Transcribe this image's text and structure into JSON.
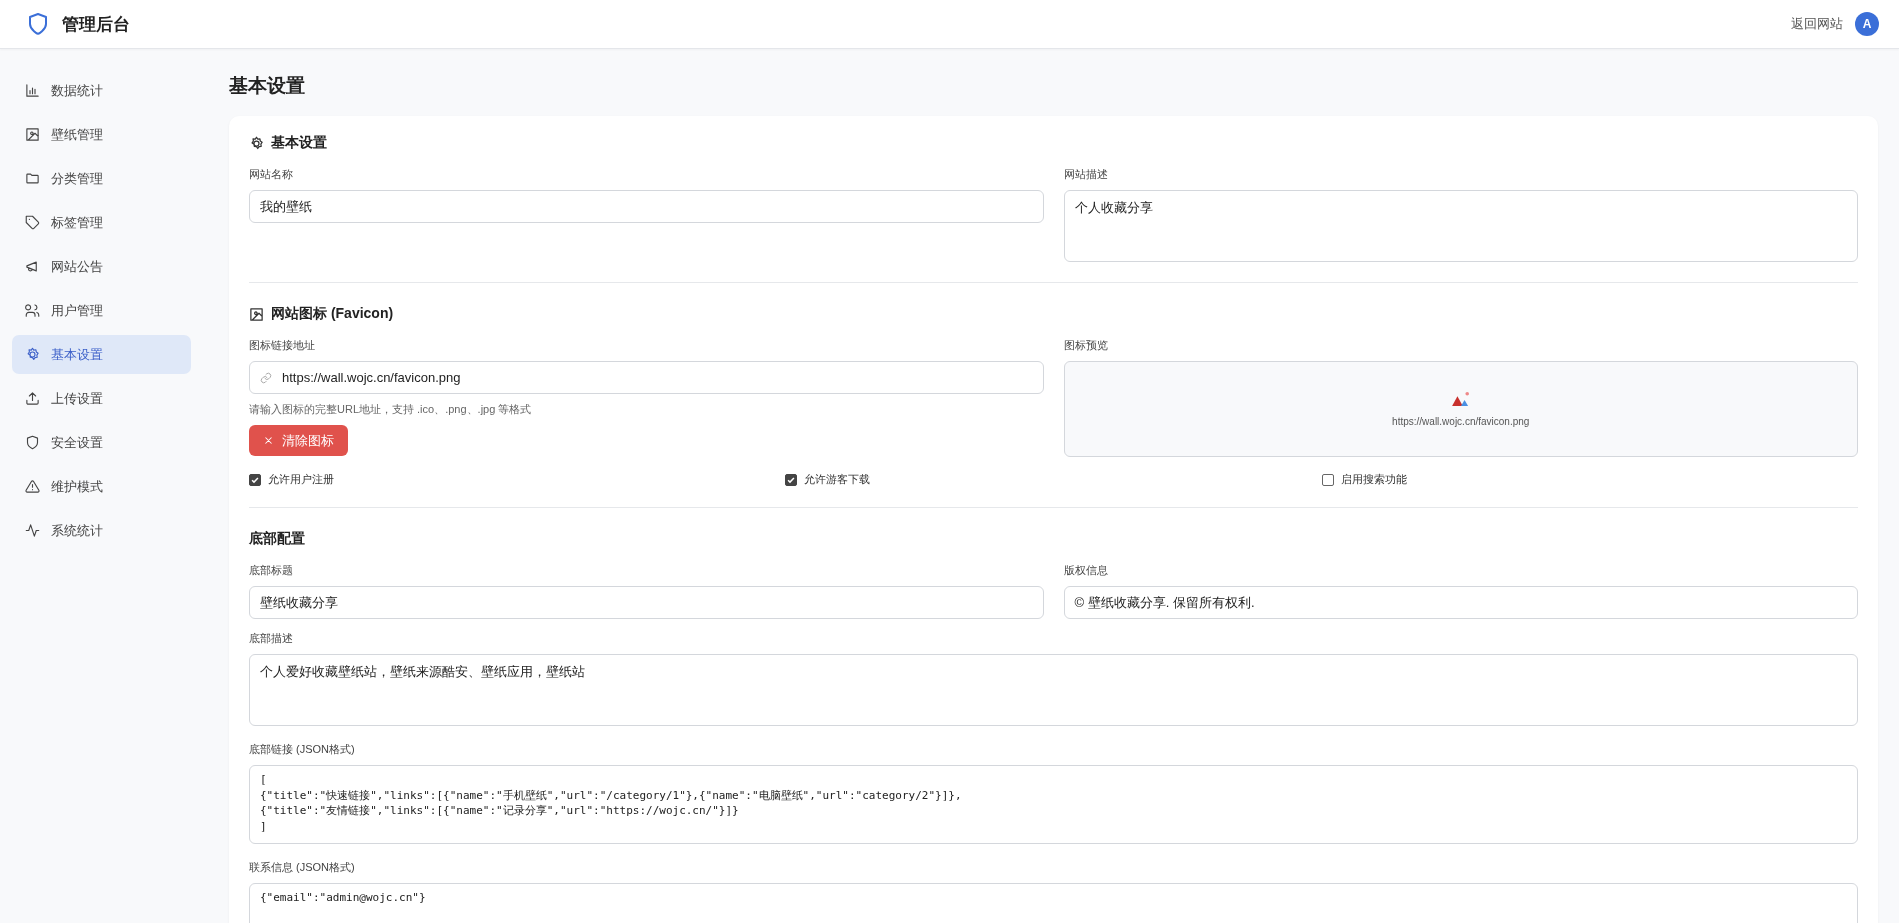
{
  "header": {
    "title": "管理后台",
    "back_link": "返回网站",
    "avatar": "A"
  },
  "sidebar": {
    "items": [
      {
        "label": "数据统计",
        "selected": false
      },
      {
        "label": "壁纸管理",
        "selected": false
      },
      {
        "label": "分类管理",
        "selected": false
      },
      {
        "label": "标签管理",
        "selected": false
      },
      {
        "label": "网站公告",
        "selected": false
      },
      {
        "label": "用户管理",
        "selected": false
      },
      {
        "label": "基本设置",
        "selected": true
      },
      {
        "label": "上传设置",
        "selected": false
      },
      {
        "label": "安全设置",
        "selected": false
      },
      {
        "label": "维护模式",
        "selected": false
      },
      {
        "label": "系统统计",
        "selected": false
      }
    ]
  },
  "page_title": "基本设置",
  "basic": {
    "title": "基本设置",
    "site_name": {
      "label": "网站名称",
      "value": "我的壁纸"
    },
    "site_desc": {
      "label": "网站描述",
      "value": "个人收藏分享"
    }
  },
  "favicon": {
    "title": "网站图标 (Favicon)",
    "url": {
      "label": "图标链接地址",
      "value": "https://wall.wojc.cn/favicon.png",
      "hint": "请输入图标的完整URL地址，支持 .ico、.png、.jpg 等格式"
    },
    "clear_button": "清除图标",
    "preview": {
      "label": "图标预览",
      "caption": "https://wall.wojc.cn/favicon.png"
    }
  },
  "toggles": [
    {
      "label": "允许用户注册",
      "checked": true
    },
    {
      "label": "允许游客下载",
      "checked": true
    },
    {
      "label": "启用搜索功能",
      "checked": false
    }
  ],
  "footer": {
    "title": "底部配置",
    "footer_title": {
      "label": "底部标题",
      "value": "壁纸收藏分享"
    },
    "copyright": {
      "label": "版权信息",
      "value": "© 壁纸收藏分享. 保留所有权利."
    },
    "description": {
      "label": "底部描述",
      "value": "个人爱好收藏壁纸站，壁纸来源酷安、壁纸应用，壁纸站"
    },
    "links": {
      "label": "底部链接 (JSON格式)",
      "value": "[\n{\"title\":\"快速链接\",\"links\":[{\"name\":\"手机壁纸\",\"url\":\"/category/1\"},{\"name\":\"电脑壁纸\",\"url\":\"category/2\"}]},\n{\"title\":\"友情链接\",\"links\":[{\"name\":\"记录分享\",\"url\":\"https://wojc.cn/\"}]}\n]"
    },
    "contact": {
      "label": "联系信息 (JSON格式)",
      "value": "{\"email\":\"admin@wojc.cn\"}"
    }
  }
}
